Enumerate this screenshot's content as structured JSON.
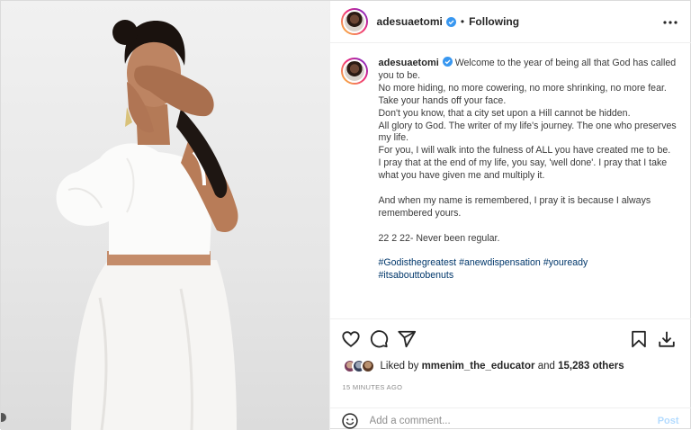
{
  "header": {
    "username": "adesuaetomi",
    "separator": "•",
    "follow_status": "Following"
  },
  "caption": {
    "username": "adesuaetomi",
    "lines": [
      "Welcome to the year of being all that God has called you to be.",
      "No more hiding, no more cowering, no more shrinking, no more fear. Take your hands off your face.",
      "Don't you know, that a city set upon a Hill cannot be hidden.",
      "All glory to God. The writer of my life's journey. The one who preserves my life.",
      "For you, I will walk into the fulness of ALL you have created me to be.",
      "I pray that at the end of my life, you say, 'well done'. I pray that I take what you have given me and multiply it.",
      "",
      "And when my name is remembered, I pray it is because I always remembered yours.",
      "",
      "22 2 22- Never been regular.",
      ""
    ],
    "hashtags": [
      "#Godisthegreatest",
      "#anewdispensation",
      "#youready",
      "#itsabouttobenuts"
    ]
  },
  "actions": {
    "like": "heart-icon",
    "comment": "comment-icon",
    "share": "share-icon",
    "save": "bookmark-icon",
    "download": "download-icon"
  },
  "likes": {
    "prefix": "Liked by",
    "user": "mmenim_the_educator",
    "and": "and",
    "count": "15,283 others"
  },
  "timestamp": "15 MINUTES AGO",
  "comment_box": {
    "placeholder": "Add a comment...",
    "post_label": "Post"
  },
  "colors": {
    "verified": "#3897f0",
    "link": "#00376b",
    "post_disabled": "#b3dbff",
    "muted": "#8e8e8e"
  }
}
